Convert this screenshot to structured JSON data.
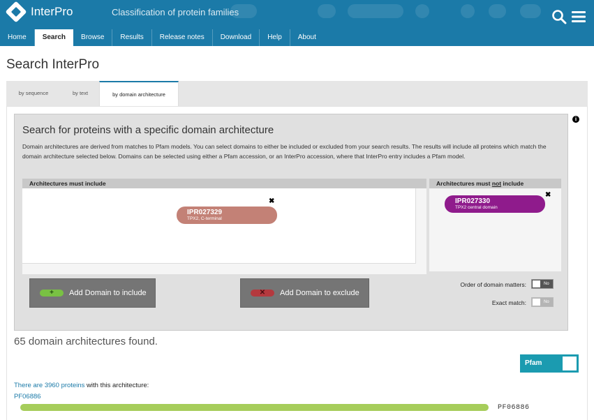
{
  "header": {
    "logo_text": "InterPro",
    "tagline": "Classification of protein families"
  },
  "nav": {
    "items": [
      "Home",
      "Search",
      "Browse",
      "Results",
      "Release notes",
      "Download",
      "Help",
      "About"
    ],
    "active": "Search"
  },
  "page": {
    "title": "Search InterPro"
  },
  "tabs": [
    "by sequence",
    "by text",
    "by domain architecture"
  ],
  "active_tab": "by domain architecture",
  "search_box": {
    "title": "Search for proteins with a specific domain architecture",
    "description": "Domain architectures are derived from matches to Pfam models. You can select domains to either be included or excluded from your search results. The results will include all proteins which match the domain architecture selected below. Domains can be selected using either a Pfam accession, or an InterPro accession, where that InterPro entry includes a Pfam model.",
    "include_heading": "Architectures must include",
    "exclude_heading_pre": "Architectures must ",
    "exclude_heading_not": "not",
    "exclude_heading_post": " include",
    "include_domains": [
      {
        "accession": "IPR027329",
        "name": "TPX2, C-terminal",
        "color": "#c38176"
      }
    ],
    "exclude_domains": [
      {
        "accession": "IPR027330",
        "name": "TPX2 central domain",
        "color": "#8f1b8c"
      }
    ],
    "add_include_label": "Add Domain to include",
    "add_exclude_label": "Add Domain to exclude",
    "order_matters_label": "Order of domain matters:",
    "order_matters_value": "No",
    "exact_match_label": "Exact match:",
    "exact_match_value": "No"
  },
  "results": {
    "count_text": "65 domain architectures found.",
    "db_toggle_label": "Pfam",
    "protein_link": "There are 3960 proteins",
    "protein_suffix": " with this architecture:",
    "architecture_link": "PF06886",
    "architecture_label": "PF06886",
    "bar_color": "#a6cd5b"
  },
  "colors": {
    "brand": "#1b7aa8",
    "include_button_domain": "#79c143",
    "exclude_button_domain": "#b4393e"
  }
}
